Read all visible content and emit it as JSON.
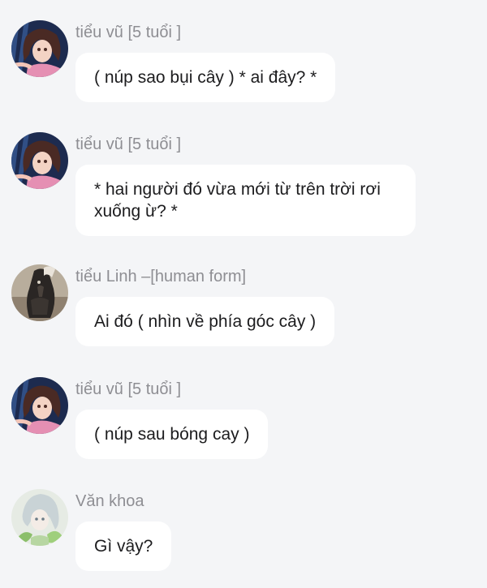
{
  "messages": [
    {
      "sender": "tiểu vũ [5 tuổi ]",
      "avatar_icon": "girl-avatar-icon",
      "text": "( núp sao bụi cây ) * ai đây? *"
    },
    {
      "sender": "tiểu vũ [5 tuổi ]",
      "avatar_icon": "girl-avatar-icon",
      "text": "* hai người đó vừa mới từ trên trời rơi xuống ừ? *"
    },
    {
      "sender": "tiểu Linh –[human form]",
      "avatar_icon": "dark-creature-avatar-icon",
      "text": "Ai đó ( nhìn về phía góc cây )"
    },
    {
      "sender": "tiểu vũ [5 tuổi ]",
      "avatar_icon": "girl-avatar-icon",
      "text": "( núp sau bóng cay )"
    },
    {
      "sender": "Văn khoa",
      "avatar_icon": "white-hair-avatar-icon",
      "text": "Gì vậy?"
    }
  ],
  "colors": {
    "background": "#f4f5f7",
    "bubble": "#ffffff",
    "sender_text": "#8e8e93",
    "message_text": "#1c1c1e"
  }
}
